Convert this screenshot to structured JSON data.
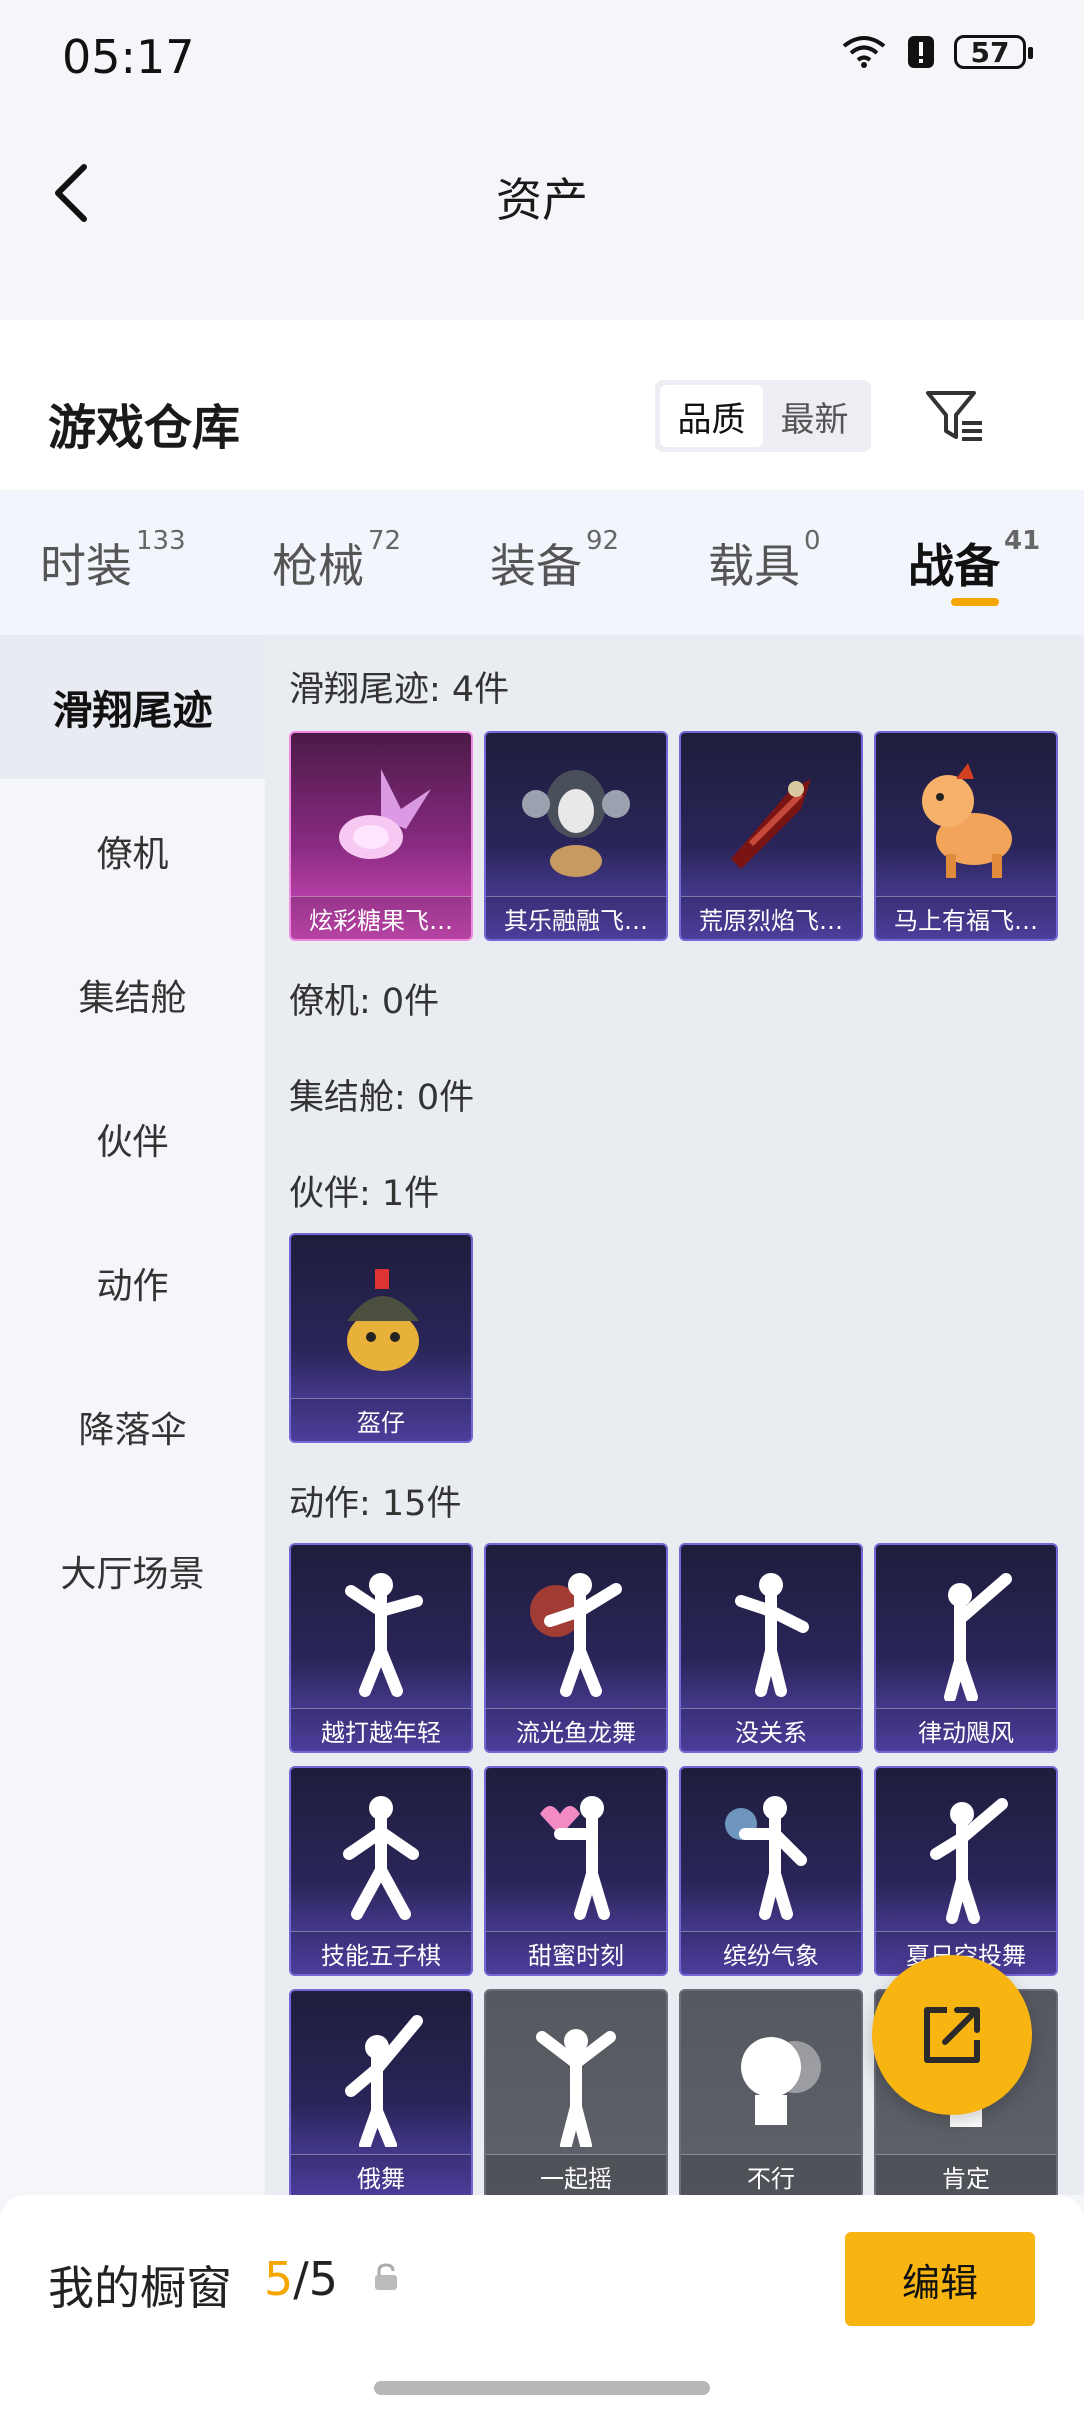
{
  "status_bar": {
    "time": "05:17",
    "battery": "57"
  },
  "header": {
    "title": "资产"
  },
  "warehouse": {
    "title": "游戏仓库",
    "sort_options": [
      "品质",
      "最新"
    ]
  },
  "tabs": [
    {
      "label": "时装",
      "count": "133"
    },
    {
      "label": "枪械",
      "count": "72"
    },
    {
      "label": "装备",
      "count": "92"
    },
    {
      "label": "载具",
      "count": "0"
    },
    {
      "label": "战备",
      "count": "41"
    }
  ],
  "sidebar": [
    "滑翔尾迹",
    "僚机",
    "集结舱",
    "伙伴",
    "动作",
    "降落伞",
    "大厅场景"
  ],
  "sections": {
    "glide": "滑翔尾迹: 4件",
    "wingman": "僚机: 0件",
    "pod": "集结舱: 0件",
    "partner": "伙伴: 1件",
    "emote": "动作: 15件"
  },
  "glide_items": [
    "炫彩糖果飞…",
    "其乐融融飞…",
    "荒原烈焰飞…",
    "马上有福飞…"
  ],
  "partner_items": [
    "盔仔"
  ],
  "emote_items": [
    "越打越年轻",
    "流光鱼龙舞",
    "没关系",
    "律动飓风",
    "技能五子棋",
    "甜蜜时刻",
    "缤纷气象",
    "夏日空投舞",
    "俄舞",
    "一起摇",
    "不行",
    "肯定"
  ],
  "bottom_bar": {
    "showcase_label": "我的橱窗",
    "current": "5",
    "total": "/5",
    "edit_label": "编辑"
  },
  "colors": {
    "accent": "#f5a600",
    "button": "#f8b512",
    "card_purple": "#5a49b6",
    "card_pink": "#d64fc0"
  }
}
